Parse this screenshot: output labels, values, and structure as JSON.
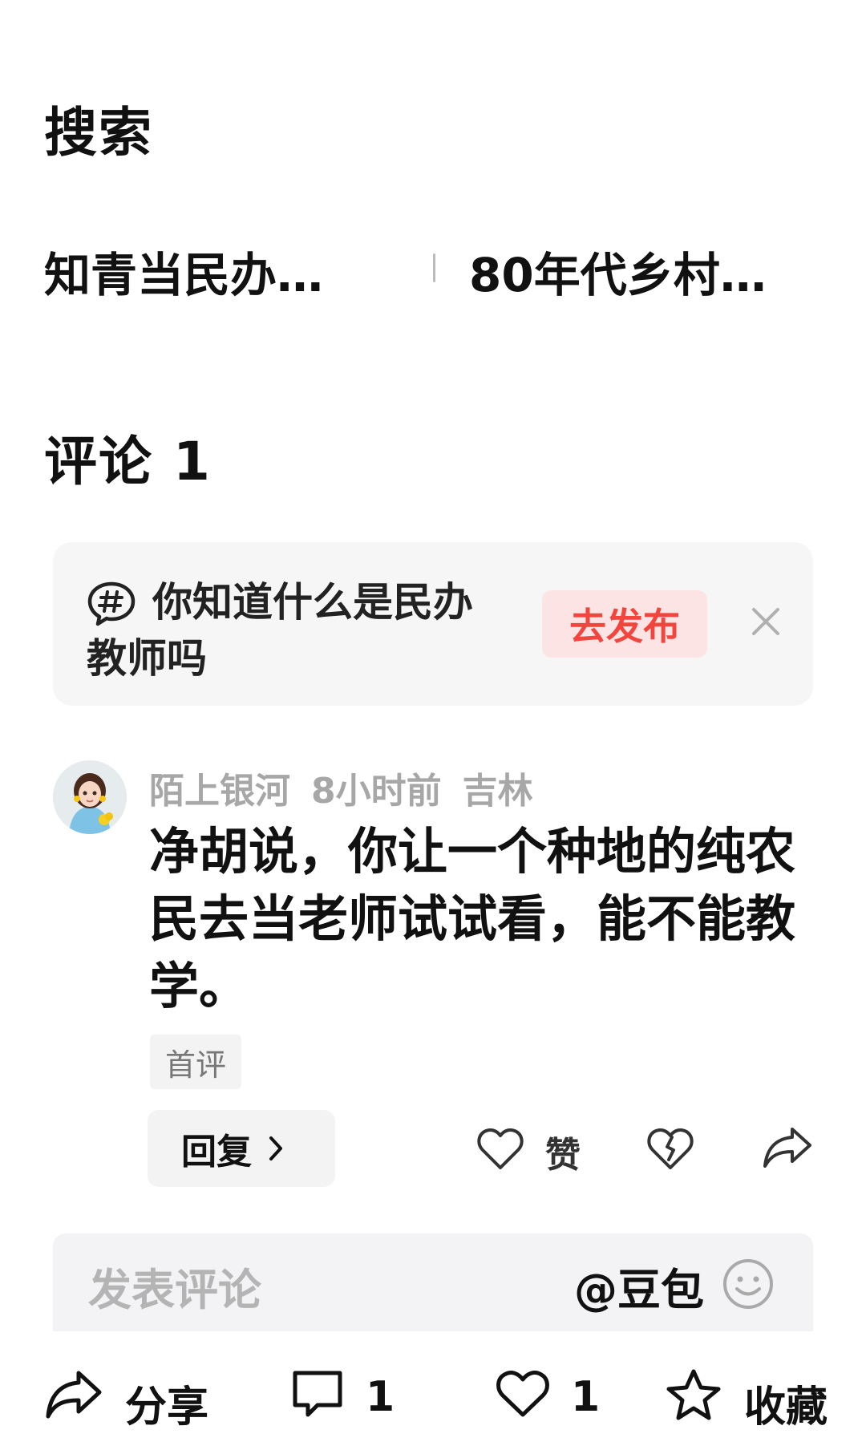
{
  "search": {
    "title": "搜索",
    "items": [
      "知青当民办…",
      "80年代乡村…"
    ]
  },
  "comments": {
    "title": "评论 1",
    "topic_card": {
      "icon": "hashtag-bubble-icon",
      "text": "你知道什么是民办教师吗",
      "publish_label": "去发布",
      "close_icon": "close-icon"
    },
    "items": [
      {
        "username": "陌上银河",
        "time": "8小时前",
        "location": "吉林",
        "text": "净胡说，你让一个种地的纯农民去当老师试试看，能不能教学。",
        "tag": "首评",
        "reply_label": "回复",
        "like_label": "赞"
      }
    ]
  },
  "input": {
    "placeholder": "发表评论",
    "mention": "@豆包",
    "emoji_icon": "smiley-icon"
  },
  "bottom_bar": {
    "share_label": "分享",
    "comment_count": "1",
    "like_count": "1",
    "favorite_label": "收藏"
  },
  "colors": {
    "accent": "#f2453d",
    "publish_bg": "#fde4e4",
    "card_bg": "#f6f6f7",
    "meta_gray": "#a7a7a7"
  }
}
